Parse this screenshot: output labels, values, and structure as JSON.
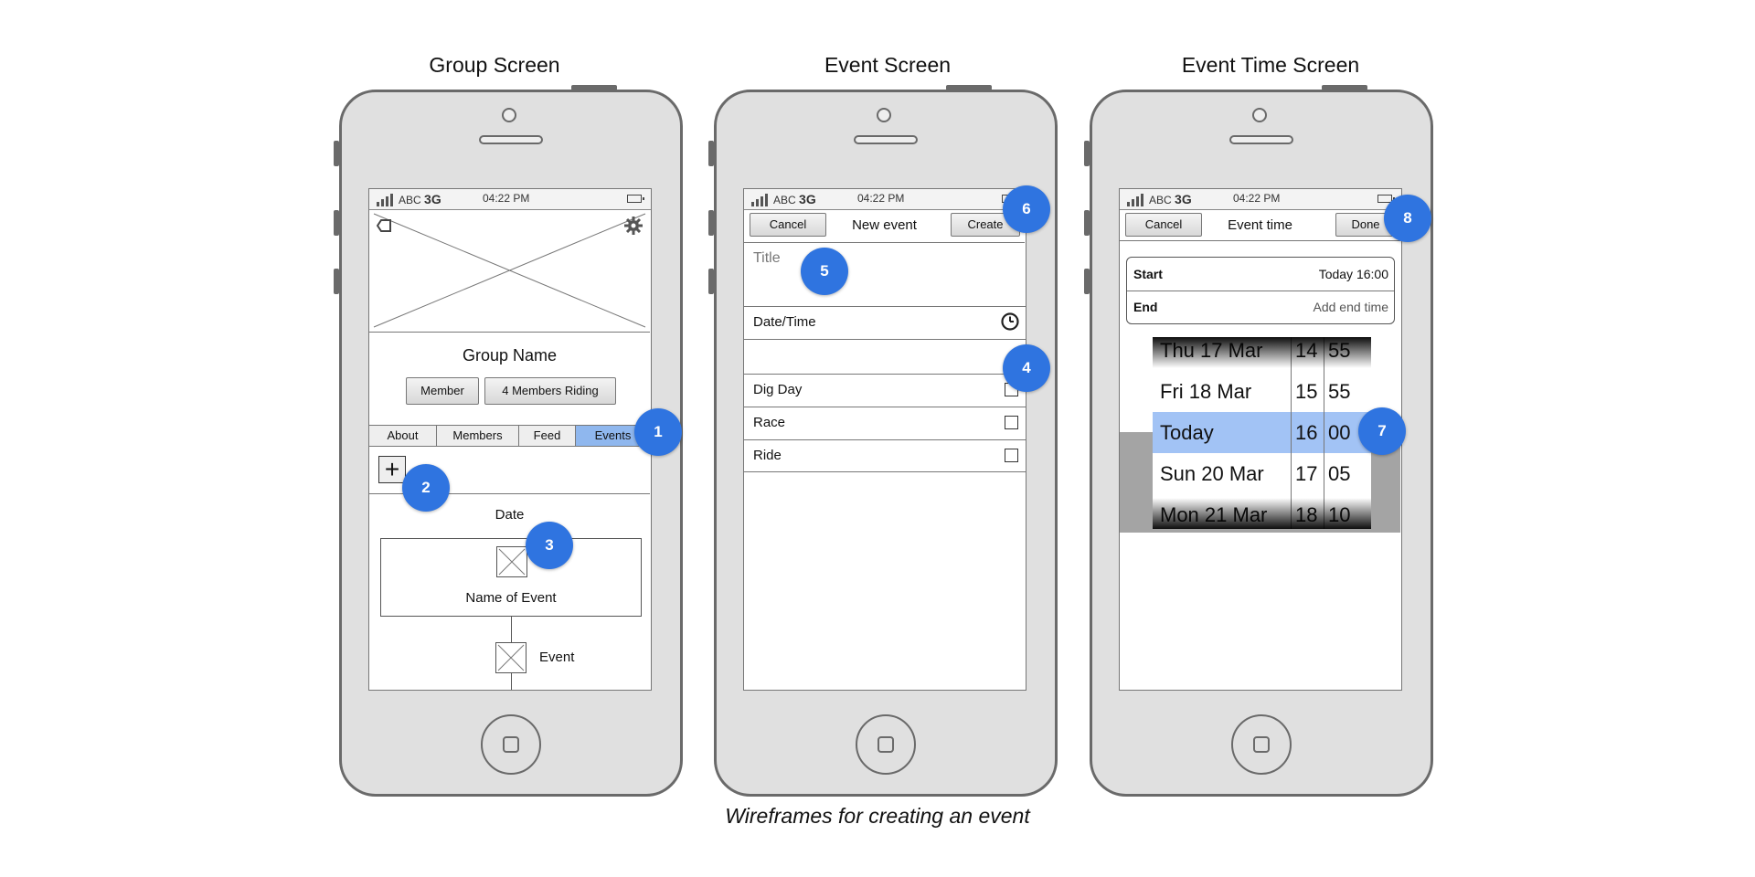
{
  "screens": {
    "group": {
      "title": "Group Screen",
      "status": {
        "carrier": "ABC",
        "network": "3G",
        "time": "04:22 PM"
      },
      "group_name": "Group Name",
      "buttons": {
        "member": "Member",
        "riding": "4 Members Riding"
      },
      "tabs": [
        "About",
        "Members",
        "Feed",
        "Events"
      ],
      "active_tab": "Events",
      "add_symbol": "+",
      "date_label": "Date",
      "event_card_name": "Name of Event",
      "event_item_label": "Event"
    },
    "event": {
      "title": "Event Screen",
      "status": {
        "carrier": "ABC",
        "network": "3G",
        "time": "04:22 PM"
      },
      "nav": {
        "cancel": "Cancel",
        "title": "New event",
        "create": "Create"
      },
      "title_placeholder": "Title",
      "datetime_label": "Date/Time",
      "options": [
        "Dig Day",
        "Race",
        "Ride"
      ]
    },
    "event_time": {
      "title": "Event Time Screen",
      "status": {
        "carrier": "ABC",
        "network": "3G",
        "time": "04:22 PM"
      },
      "nav": {
        "cancel": "Cancel",
        "title": "Event time",
        "done": "Done"
      },
      "start_label": "Start",
      "start_value": "Today 16:00",
      "end_label": "End",
      "end_value": "Add end time",
      "picker": {
        "days": [
          "Thu 17 Mar",
          "Fri 18 Mar",
          "Today",
          "Sun 20 Mar",
          "Mon 21 Mar"
        ],
        "hours": [
          "14",
          "15",
          "16",
          "17",
          "18"
        ],
        "minutes": [
          "55",
          "55",
          "00",
          "05",
          "10"
        ],
        "selected_index": 2
      }
    }
  },
  "markers": [
    "1",
    "2",
    "3",
    "4",
    "5",
    "6",
    "7",
    "8"
  ],
  "caption": "Wireframes for creating an event",
  "colors": {
    "marker": "#2f74e0",
    "selected_row": "#a2c3f5",
    "active_tab": "#8fb7ee"
  }
}
